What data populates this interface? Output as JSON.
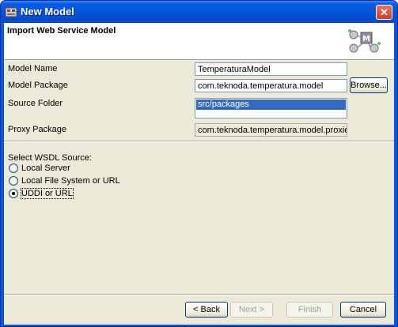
{
  "window": {
    "title": "New Model",
    "close_glyph": "✕"
  },
  "header": {
    "title": "Import Web Service Model",
    "banner_icon": "wizard-banner-icon"
  },
  "form": {
    "model_name_label": "Model Name",
    "model_name_value": "TemperaturaModel",
    "model_package_label": "Model Package",
    "model_package_value": "com.teknoda.temperatura.model",
    "browse_label": "Browse...",
    "source_folder_label": "Source Folder",
    "source_folder_items": [
      "src/packages"
    ],
    "proxy_package_label": "Proxy Package",
    "proxy_package_value": "com.teknoda.temperatura.model.proxies"
  },
  "wsdl": {
    "heading": "Select WSDL Source:",
    "options": [
      {
        "label": "Local Server",
        "checked": false
      },
      {
        "label": "Local File System or URL",
        "checked": false
      },
      {
        "label": "UDDI or URL",
        "checked": true
      }
    ]
  },
  "buttons": {
    "back": "< Back",
    "next": "Next >",
    "finish": "Finish",
    "cancel": "Cancel"
  },
  "colors": {
    "title_bar": "#0a55e0",
    "dialog_bg": "#ece9d8",
    "selection": "#316ac5"
  }
}
